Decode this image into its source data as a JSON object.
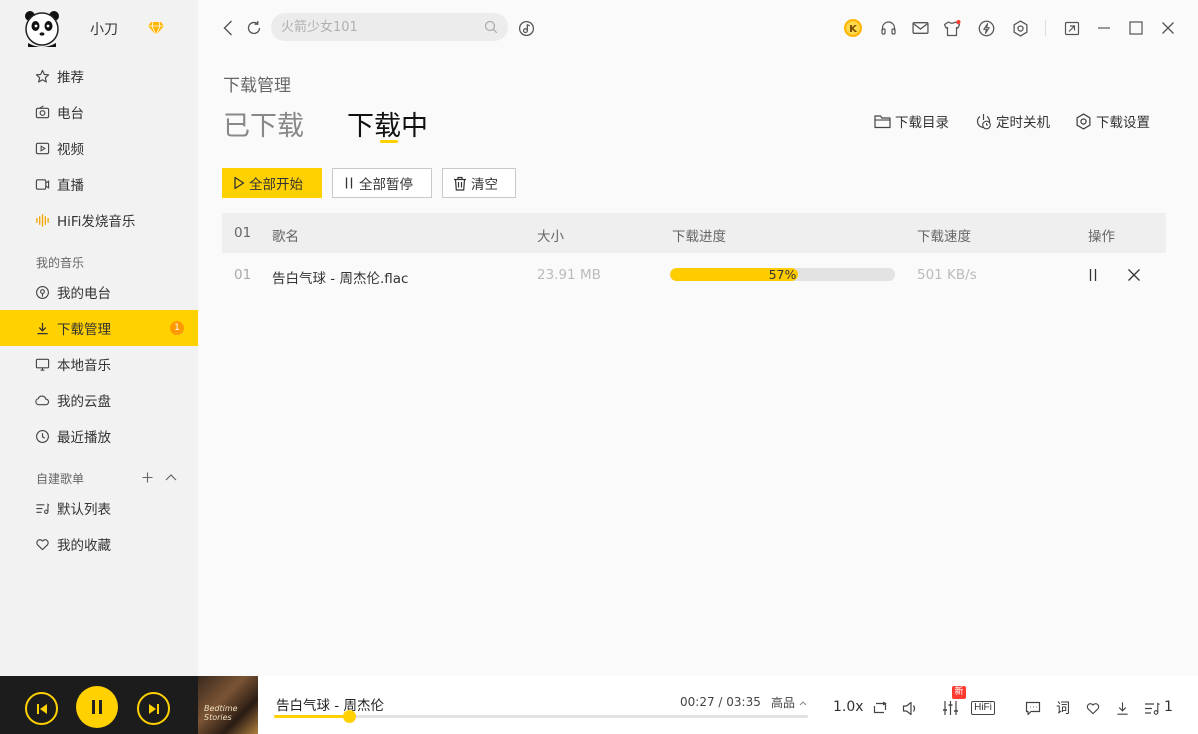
{
  "sidebar": {
    "username": "小刀",
    "items_main": [
      {
        "label": "推荐",
        "icon": "star-icon"
      },
      {
        "label": "电台",
        "icon": "radio-icon"
      },
      {
        "label": "视频",
        "icon": "video-icon"
      },
      {
        "label": "直播",
        "icon": "live-icon"
      },
      {
        "label": "HiFi发烧音乐",
        "icon": "hifi-wave-icon"
      }
    ],
    "section_my_music": "我的音乐",
    "items_my_music": [
      {
        "label": "我的电台",
        "icon": "my-radio-icon"
      },
      {
        "label": "下载管理",
        "icon": "download-icon",
        "badge": "1",
        "active": true
      },
      {
        "label": "本地音乐",
        "icon": "monitor-icon"
      },
      {
        "label": "我的云盘",
        "icon": "cloud-icon"
      },
      {
        "label": "最近播放",
        "icon": "clock-icon"
      }
    ],
    "section_playlists": "自建歌单",
    "items_playlists": [
      {
        "label": "默认列表",
        "icon": "list-icon"
      },
      {
        "label": "我的收藏",
        "icon": "heart-icon"
      }
    ]
  },
  "topbar": {
    "search_placeholder": "火箭少女101"
  },
  "main": {
    "page_title": "下载管理",
    "tabs": [
      {
        "label": "已下载",
        "active": false
      },
      {
        "label": "下载中",
        "active": true
      }
    ],
    "header_actions": [
      "下载目录",
      "定时关机",
      "下载设置"
    ],
    "buttons": {
      "start_all": "全部开始",
      "pause_all": "全部暂停",
      "clear": "清空"
    },
    "table": {
      "columns": [
        "01",
        "歌名",
        "大小",
        "下载进度",
        "下载速度",
        "操作"
      ],
      "rows": [
        {
          "index": "01",
          "name": "告白气球 - 周杰伦.flac",
          "size": "23.91 MB",
          "progress": 57,
          "progress_label": "57%",
          "speed": "501 KB/s"
        }
      ]
    }
  },
  "player": {
    "track": "告白气球 - 周杰伦",
    "time": "00:27 / 03:35",
    "progress_fraction": 0.14,
    "quality": "高品",
    "speed": "1.0x",
    "new_badge": "新",
    "hifi_label": "HiFi",
    "lyrics_label": "词",
    "playlist_count": "1",
    "album_text": "Bedtime Stories"
  },
  "colors": {
    "accent": "#ffd100",
    "sidebar_bg": "#f2f2f2",
    "player_dark": "#1c1c1c"
  }
}
